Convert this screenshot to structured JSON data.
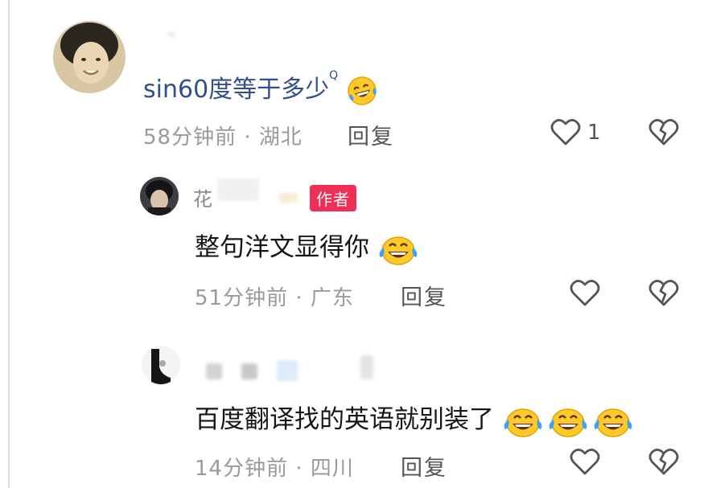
{
  "comments": [
    {
      "text": "sin60度等于多少",
      "superscript": "Q",
      "time_location": "58分钟前 · 湖北",
      "reply_label": "回复",
      "like_count": "1"
    },
    {
      "username": "花",
      "username_tail": "​",
      "badge": "作者",
      "text": "整句洋文显得你",
      "time_location": "51分钟前 · 广东",
      "reply_label": "回复"
    },
    {
      "text": "百度翻译找的英语就别装了",
      "time_location": "14分钟前 · 四川",
      "reply_label": "回复"
    }
  ],
  "icons": {
    "like": "heart-outline-icon",
    "dislike": "broken-heart-icon",
    "emoji": "laughing-tears-emoji"
  },
  "colors": {
    "badge": "#ef2f55",
    "link_text": "#2f4f8f",
    "meta": "#9a9a9a"
  }
}
